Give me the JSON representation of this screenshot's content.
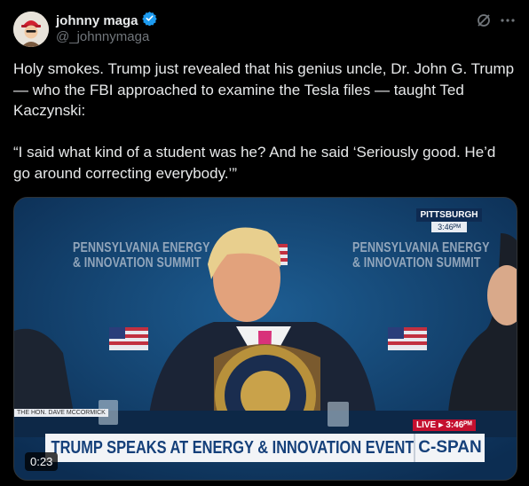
{
  "author": {
    "name": "johnny maga",
    "handle": "@_johnnymaga"
  },
  "tweet": {
    "text": "Holy smokes. Trump just revealed that his genius uncle, Dr. John G. Trump — who the FBI approached to examine the Tesla files — taught Ted Kaczynski:\n\n“I said what kind of a student was he? And he said ‘Seriously good. He’d go around correcting everybody.’”"
  },
  "media": {
    "duration": "0:23",
    "backdrop_text": "PENNSYLVANIA ENERGY\n& INNOVATION SUMMIT",
    "location": "PITTSBURGH",
    "location_time": "3:46ᴾᴹ",
    "nameplate": "THE HON. DAVE MCCORMICK",
    "live_label": "LIVE",
    "live_time": "3:46ᴾᴹ",
    "chyron": "TRUMP SPEAKS AT ENERGY & INNOVATION EVENT",
    "network": "C-SPAN"
  },
  "colors": {
    "verified": "#1d9bf0",
    "chyron_text": "#15407a",
    "live": "#c4102f"
  }
}
